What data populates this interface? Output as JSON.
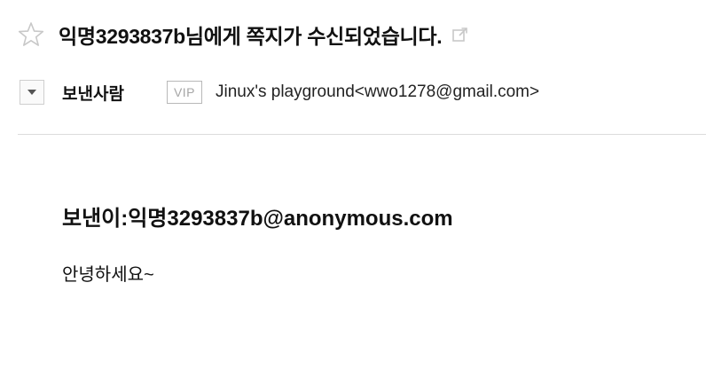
{
  "message": {
    "subject": "익명3293837b님에게 쪽지가 수신되었습니다.",
    "starred": false,
    "sender_label": "보낸사람",
    "vip_label": "VIP",
    "sender_value": "Jinux's playground<wwo1278@gmail.com>",
    "body_sender": "보낸이:익명3293837b@anonymous.com",
    "body_text": "안녕하세요~"
  },
  "icons": {
    "star": "star-outline-icon",
    "popout": "external-link-icon",
    "toggle": "caret-down-icon"
  },
  "colors": {
    "icon_gray": "#c8c8c8",
    "divider": "#dcdcdc",
    "text": "#111111"
  }
}
